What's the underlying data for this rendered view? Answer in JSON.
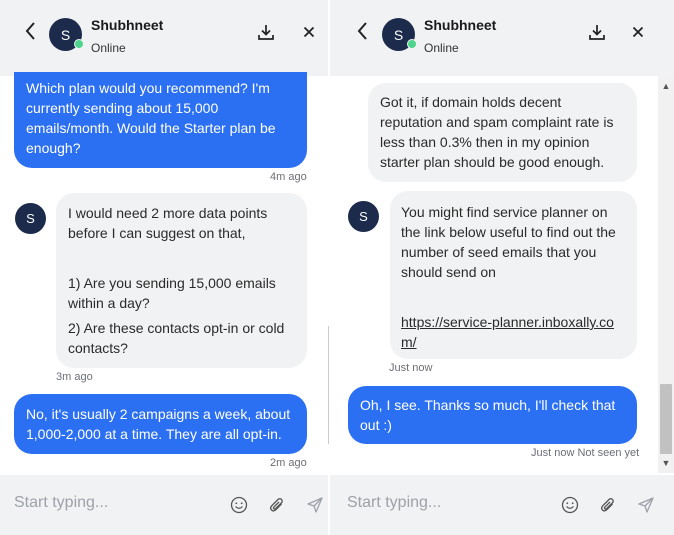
{
  "contact": {
    "name": "Shubhneet",
    "status": "Online",
    "initial": "S"
  },
  "left": {
    "messages": [
      {
        "text": "Which plan would you recommend? I'm currently sending about 15,000 emails/month. Would the Starter plan be enough?",
        "time": "4m ago"
      },
      {
        "lines": [
          "I would need 2 more data points before I can suggest on that,",
          "1) Are you sending 15,000 emails within a day?",
          "2) Are these contacts opt-in or cold contacts?"
        ],
        "time": "3m ago"
      },
      {
        "text": "No, it's usually 2 campaigns a week, about 1,000-2,000 at a time. They are all opt-in.",
        "time": "2m ago"
      }
    ],
    "composer_placeholder": "Start typing..."
  },
  "right": {
    "messages": [
      {
        "text": "Got it, if domain holds decent reputation and spam complaint rate is less than 0.3% then in my opinion starter plan should be good enough."
      },
      {
        "text": "You might find service planner on the link below useful to find out the number of seed emails that you should send on",
        "link": "https://service-planner.inboxally.com/",
        "time": "Just now"
      },
      {
        "text": "Oh, I see. Thanks so much, I'll check that out :)",
        "time": "Just now Not seen yet"
      }
    ],
    "composer_placeholder": "Start typing..."
  },
  "icons": {
    "back": "chevron-left-icon",
    "download": "download-icon",
    "close": "close-icon",
    "emoji": "smiley-icon",
    "attach": "paperclip-icon",
    "send": "send-icon"
  },
  "colors": {
    "outgoing_bubble": "#2b6ff3",
    "incoming_bubble": "#f1f2f4",
    "avatar": "#1c2a4b",
    "online": "#4ed58b"
  }
}
